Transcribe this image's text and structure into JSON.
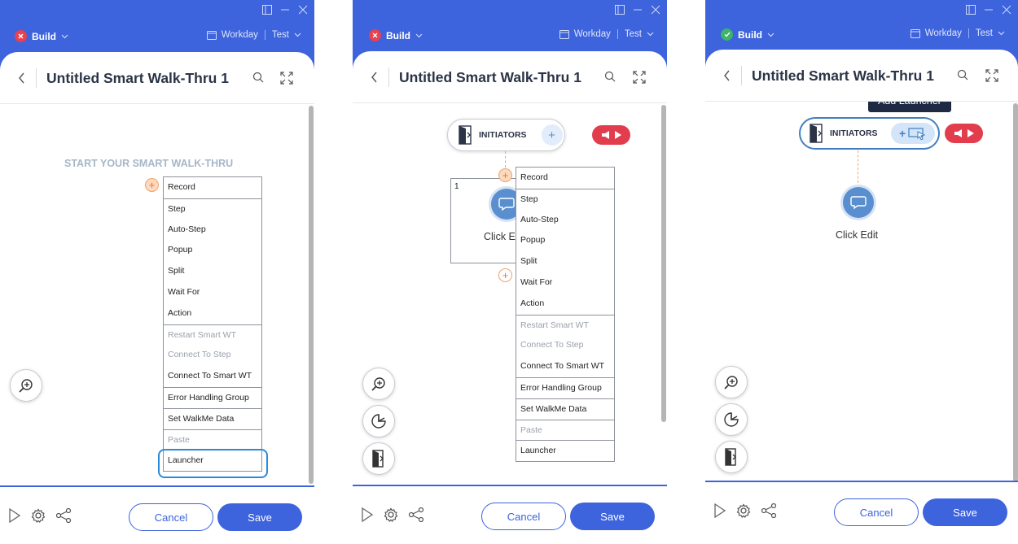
{
  "panels": [
    {
      "build_label": "Build",
      "build_status": "error",
      "env_app": "Workday",
      "env_name": "Test",
      "title": "Untitled Smart Walk-Thru 1",
      "start_label": "START YOUR SMART WALK-THRU",
      "menu": [
        "Record",
        "Step",
        "Auto-Step",
        "Popup",
        "Split",
        "Wait For",
        "Action",
        "Restart Smart WT",
        "Connect To Step",
        "Connect To Smart WT",
        "Error Handling Group",
        "Set WalkMe Data",
        "Paste",
        "Launcher"
      ],
      "highlighted_item": "Launcher",
      "cancel_label": "Cancel",
      "save_label": "Save"
    },
    {
      "build_label": "Build",
      "build_status": "error",
      "env_app": "Workday",
      "env_name": "Test",
      "title": "Untitled Smart Walk-Thru 1",
      "initiators_label": "INITIATORS",
      "step_number": "1",
      "step_label": "Click Edit",
      "menu": [
        "Record",
        "Step",
        "Auto-Step",
        "Popup",
        "Split",
        "Wait For",
        "Action",
        "Restart Smart WT",
        "Connect To Step",
        "Connect To Smart WT",
        "Error Handling Group",
        "Set WalkMe Data",
        "Paste",
        "Launcher"
      ],
      "cancel_label": "Cancel",
      "save_label": "Save"
    },
    {
      "build_label": "Build",
      "build_status": "ok",
      "env_app": "Workday",
      "env_name": "Test",
      "title": "Untitled Smart Walk-Thru 1",
      "initiators_label": "INITIATORS",
      "tooltip": "Add Launcher",
      "step_label": "Click Edit",
      "cancel_label": "Cancel",
      "save_label": "Save"
    }
  ],
  "colors": {
    "brand": "#3d63dd",
    "error": "#e8414f",
    "ok": "#3db36b",
    "node": "#5a8fcf",
    "orange": "#f2a36a"
  }
}
